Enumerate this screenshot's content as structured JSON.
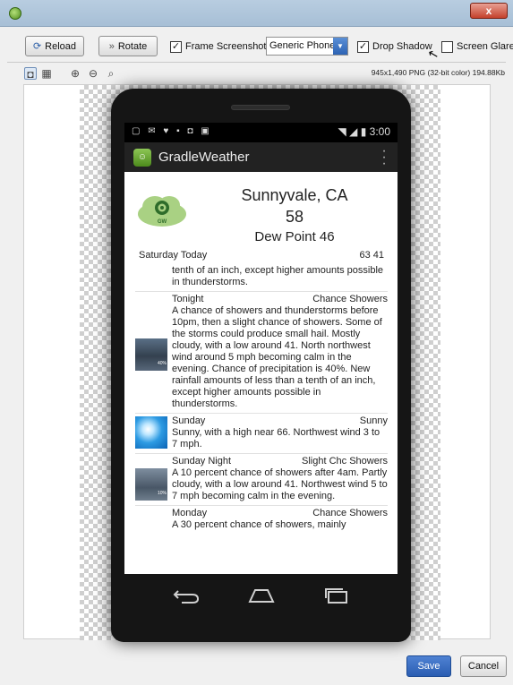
{
  "window": {
    "close_label": "x"
  },
  "toolbar": {
    "reload_label": "Reload",
    "rotate_label": "Rotate",
    "frame_screenshot": {
      "label": "Frame Screenshot",
      "checked": true
    },
    "device_select": {
      "value": "Generic Phone"
    },
    "drop_shadow": {
      "label": "Drop Shadow",
      "checked": true
    },
    "screen_glare": {
      "label": "Screen Glare",
      "checked": false
    }
  },
  "image_info": "945x1,490 PNG (32-bit color) 194.88Kb",
  "phone": {
    "status_time": "3:00",
    "app_title": "GradleWeather",
    "logo_text": "GW",
    "city": "Sunnyvale, CA",
    "temperature": "58",
    "dew_point": "Dew Point 46",
    "today": {
      "label": "Saturday Today",
      "hilo": "63 41"
    },
    "forecast": [
      {
        "period": "",
        "summary": "",
        "text": "tenth of an inch, except higher amounts possible in thunderstorms.",
        "image": null
      },
      {
        "period": "Tonight",
        "summary": "Chance Showers",
        "text": "A chance of showers and thunderstorms before 10pm, then a slight chance of showers. Some of the storms could produce small hail.  Mostly cloudy, with a low around 41. North northwest wind around 5 mph becoming calm  in the evening.  Chance of precipitation is 40%. New rainfall amounts of less than a tenth of an inch, except higher amounts possible in thunderstorms.",
        "image": "storm",
        "badge": "40%"
      },
      {
        "period": "Sunday",
        "summary": "Sunny",
        "text": "Sunny, with a high near 66. Northwest wind 3 to 7 mph.",
        "image": "sun"
      },
      {
        "period": "Sunday Night",
        "summary": "Slight Chc Showers",
        "text": "A 10 percent chance of showers after 4am. Partly cloudy, with a low around 41. Northwest wind 5 to 7 mph becoming calm in the evening.",
        "image": "cloud",
        "badge": "10%"
      },
      {
        "period": "Monday",
        "summary": "Chance Showers",
        "text": "A 30 percent chance of showers, mainly",
        "image": null
      }
    ]
  },
  "footer": {
    "save_label": "Save",
    "cancel_label": "Cancel"
  },
  "colors": {
    "accent_blue": "#2d63b4",
    "titlebar": "#b8cde0",
    "close_red": "#c4412c"
  }
}
